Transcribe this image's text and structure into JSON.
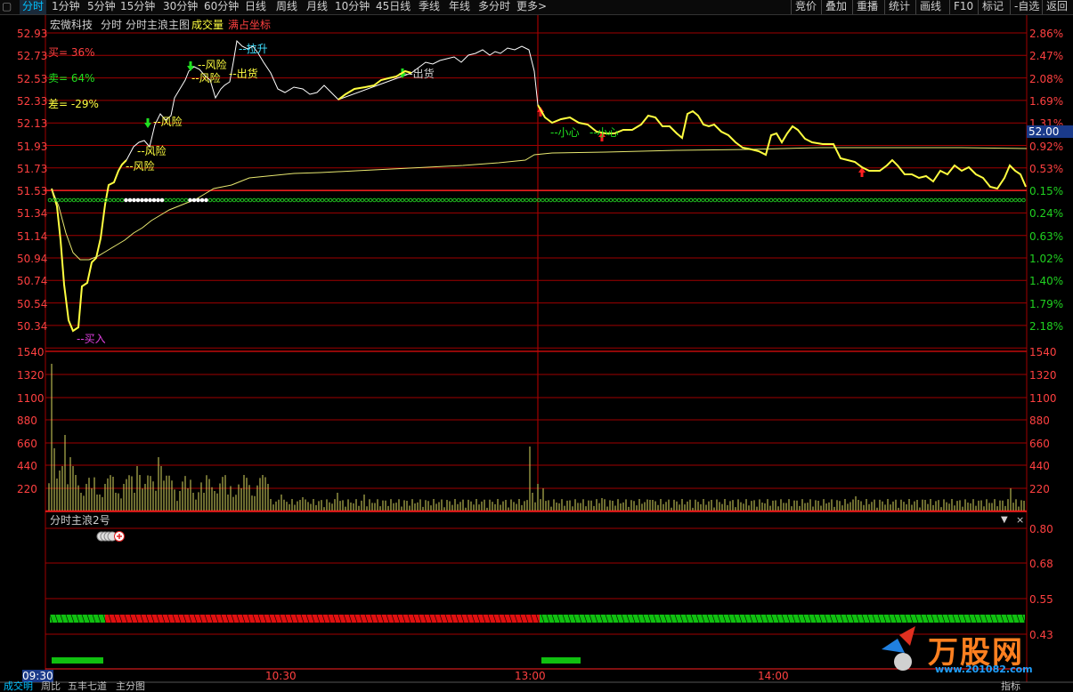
{
  "toolbar": {
    "tabs": [
      "分时",
      "1分钟",
      "5分钟",
      "15分钟",
      "30分钟",
      "60分钟",
      "日线",
      "周线",
      "月线",
      "10分钟",
      "45日线",
      "季线",
      "年线",
      "多分时",
      "更多>"
    ],
    "right": [
      "竞价",
      "叠加",
      "重播",
      "统计",
      "画线",
      "F10",
      "标记",
      "-自选",
      "返回"
    ]
  },
  "header": {
    "stock_name": "宏微科技",
    "view": "分时",
    "indicator": "分时主浪主图",
    "volume_label": "成交量",
    "fill_label": "满占坐标"
  },
  "left_stats": {
    "buy": "买= 36%",
    "sell": "卖= 64%",
    "diff": "差= -29%"
  },
  "price_axis": [
    "52.93",
    "52.73",
    "52.53",
    "52.33",
    "52.13",
    "51.93",
    "51.73",
    "51.53",
    "51.34",
    "51.14",
    "50.94",
    "50.74",
    "50.54",
    "50.34"
  ],
  "pct_axis": [
    "2.86%",
    "2.47%",
    "2.08%",
    "1.69%",
    "1.31%",
    "0.92%",
    "0.53%",
    "0.15%",
    "0.24%",
    "0.63%",
    "1.02%",
    "1.40%",
    "1.79%",
    "2.18%"
  ],
  "current_price": "52.00",
  "vol_axis": [
    "1540",
    "1320",
    "1100",
    "880",
    "660",
    "440",
    "220"
  ],
  "sub_panel": {
    "title": "分时主浪2号",
    "axis": [
      "0.80",
      "0.68",
      "0.55",
      "0.43"
    ]
  },
  "time_axis": [
    "09:30",
    "10:30",
    "13:00",
    "14:00"
  ],
  "annotations": {
    "buy_in": "--买入",
    "risk": "--风险",
    "ship": "--出货",
    "pull_up": "--拉升",
    "careful": "--小心",
    "careful2": "--小心"
  },
  "bottom_tabs": [
    "成交明",
    "周比",
    "五丰七道",
    "主分图"
  ],
  "bottom_right": "指标",
  "watermark": "万股网",
  "watermark_url": "www.201082.com",
  "colors": {
    "grid": "#a00000",
    "price": "#ffff40",
    "avg": "#ffff80",
    "white_line": "#ffffff",
    "green": "#20e020",
    "red": "#ff2020"
  }
}
